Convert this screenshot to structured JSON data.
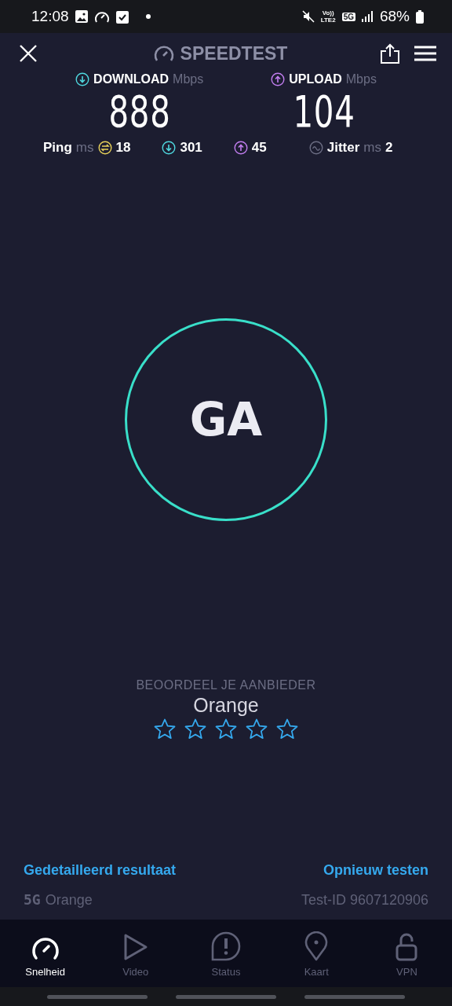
{
  "status_bar": {
    "time": "12:08",
    "volte_top": "Vo))",
    "volte_bottom": "LTE2",
    "network": "5G",
    "battery": "68%"
  },
  "header": {
    "title": "SPEEDTEST"
  },
  "results": [
    {
      "kind": "download",
      "label": "DOWNLOAD",
      "unit": "Mbps",
      "value": "888"
    },
    {
      "kind": "upload",
      "label": "UPLOAD",
      "unit": "Mbps",
      "value": "104"
    }
  ],
  "ping": {
    "label": "Ping",
    "unit": "ms",
    "idle": "18",
    "download": "301",
    "upload": "45"
  },
  "jitter": {
    "label": "Jitter",
    "unit": "ms",
    "value": "2"
  },
  "go_button": "GA",
  "rating": {
    "prompt": "BEOORDEEL JE AANBIEDER",
    "provider": "Orange",
    "stars": 0
  },
  "links": [
    "Gedetailleerd resultaat",
    "Opnieuw testen"
  ],
  "connection": {
    "network": "5G",
    "provider": "Orange",
    "test_id": "Test-ID 9607120906"
  },
  "nav": [
    {
      "label": "Snelheid",
      "kind": "gauge",
      "selected": true
    },
    {
      "label": "Video",
      "kind": "play",
      "selected": false
    },
    {
      "label": "Status",
      "kind": "alert",
      "selected": false
    },
    {
      "label": "Kaart",
      "kind": "pin",
      "selected": false
    },
    {
      "label": "VPN",
      "kind": "lock",
      "selected": false
    }
  ]
}
